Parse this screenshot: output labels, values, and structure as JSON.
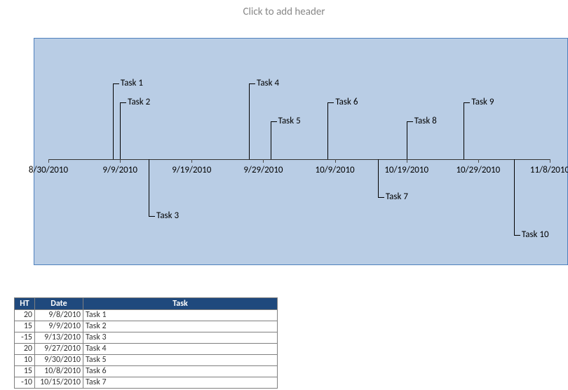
{
  "header_hint": "Click to add header",
  "chart_data": {
    "type": "scatter",
    "title": "",
    "xlabel": "",
    "ylabel": "",
    "x_axis_ticks": [
      "8/30/2010",
      "9/9/2010",
      "9/19/2010",
      "9/29/2010",
      "10/9/2010",
      "10/19/2010",
      "10/29/2010",
      "11/8/2010"
    ],
    "series": [
      {
        "name": "Task 1",
        "date": "9/8/2010",
        "height": 20
      },
      {
        "name": "Task 2",
        "date": "9/9/2010",
        "height": 15
      },
      {
        "name": "Task 3",
        "date": "9/13/2010",
        "height": -15
      },
      {
        "name": "Task 4",
        "date": "9/27/2010",
        "height": 20
      },
      {
        "name": "Task 5",
        "date": "9/30/2010",
        "height": 10
      },
      {
        "name": "Task 6",
        "date": "10/8/2010",
        "height": 15
      },
      {
        "name": "Task 7",
        "date": "10/15/2010",
        "height": -10
      },
      {
        "name": "Task 8",
        "date": "10/19/2010",
        "height": 10
      },
      {
        "name": "Task 9",
        "date": "10/27/2010",
        "height": 15
      },
      {
        "name": "Task 10",
        "date": "11/3/2010",
        "height": -20
      }
    ],
    "ylim": [
      -20,
      20
    ]
  },
  "table": {
    "headers": {
      "ht": "HT",
      "date": "Date",
      "task": "Task"
    },
    "rows": [
      {
        "ht": "20",
        "date": "9/8/2010",
        "task": "Task 1"
      },
      {
        "ht": "15",
        "date": "9/9/2010",
        "task": "Task 2"
      },
      {
        "ht": "-15",
        "date": "9/13/2010",
        "task": "Task 3"
      },
      {
        "ht": "20",
        "date": "9/27/2010",
        "task": "Task 4"
      },
      {
        "ht": "10",
        "date": "9/30/2010",
        "task": "Task 5"
      },
      {
        "ht": "15",
        "date": "10/8/2010",
        "task": "Task 6"
      },
      {
        "ht": "-10",
        "date": "10/15/2010",
        "task": "Task 7"
      }
    ]
  },
  "colors": {
    "chart_bg": "#b9cde5",
    "chart_border": "#4f81bd",
    "table_header_bg": "#1f497d"
  }
}
